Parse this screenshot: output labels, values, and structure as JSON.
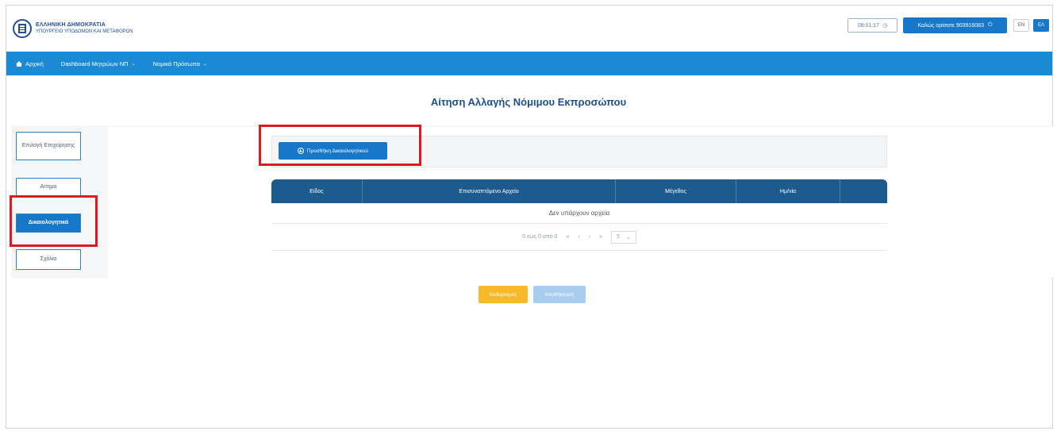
{
  "header": {
    "logo_line1": "ΕΛΛΗΝΙΚΗ ΔΗΜΟΚΡΑΤΙΑ",
    "logo_line2": "ΥΠΟΥΡΓΕΙΟ ΥΠΟΔΟΜΩΝ ΚΑΙ ΜΕΤΑΦΟΡΩΝ",
    "timer": "08:01:17",
    "timer_icon": "clock-icon",
    "user_label": "Καλώς ορίσατε 903916083",
    "logout_icon": "power-icon",
    "lang_en": "EN",
    "lang_el": "ΕΛ"
  },
  "nav": {
    "home": "Αρχική",
    "dashboard": "Dashboard Μητρώων ΝΠ",
    "legal_entities": "Νομικά Πρόσωπα"
  },
  "page": {
    "title": "Αίτηση Αλλαγής Νόμιμου Εκπροσώπου"
  },
  "steps": [
    {
      "label": "Επιλογή Επιχείρησης"
    },
    {
      "label": "Αίτημα"
    },
    {
      "label": "Δικαιολογητικά"
    },
    {
      "label": "Σχόλια"
    }
  ],
  "toolbar": {
    "add_label": "Προσθήκη Δικαιολογητικού"
  },
  "table": {
    "columns": [
      "Είδος",
      "Επισυναπτόμενο Αρχείο",
      "Μέγεθος",
      "Ημ/νία",
      ""
    ],
    "empty_message": "Δεν υπάρχουν αρχεία",
    "pager_text": "0 εώς 0 από 0",
    "pager_first": "«",
    "pager_prev": "‹",
    "pager_next": "›",
    "pager_last": "»",
    "page_size": "5"
  },
  "actions": {
    "cancel": "Καθαρισμός",
    "submit": "Αποθήκευση"
  },
  "colors": {
    "primary": "#1777c8",
    "nav": "#1a8ad4",
    "table_header": "#1d5a8e",
    "highlight": "#d91c24",
    "warning": "#f7b82a"
  }
}
